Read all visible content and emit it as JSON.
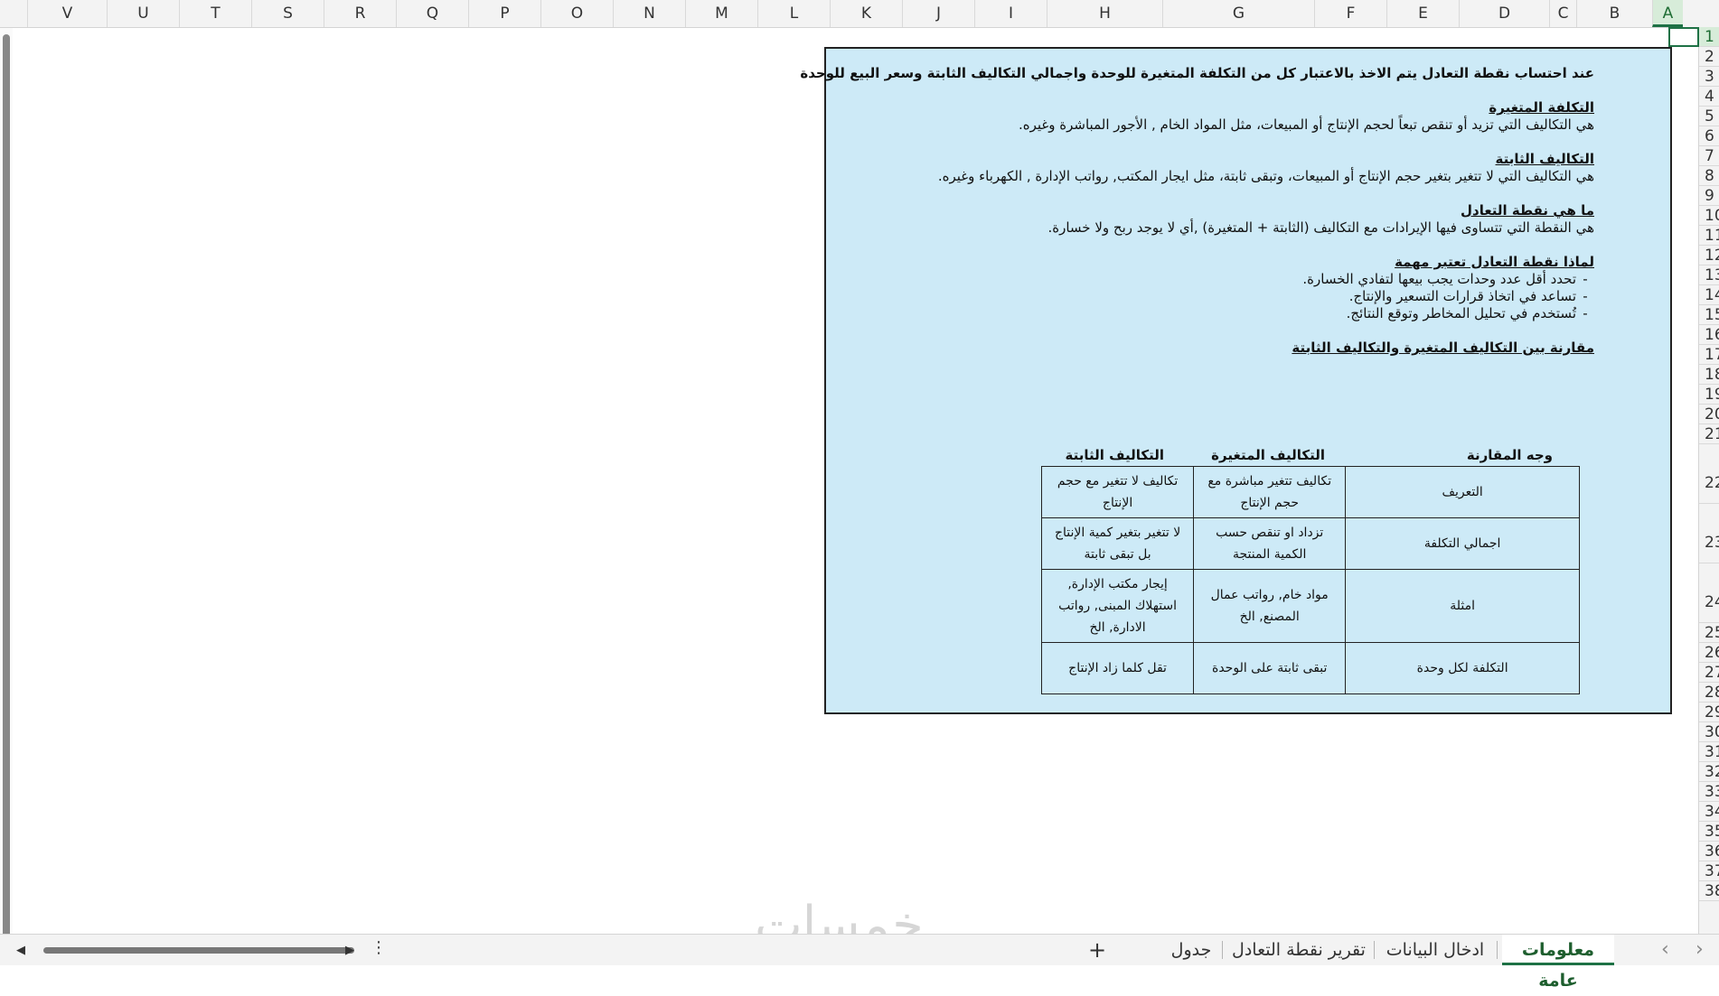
{
  "columns": [
    {
      "letter": "V"
    },
    {
      "letter": "U"
    },
    {
      "letter": "T"
    },
    {
      "letter": "S"
    },
    {
      "letter": "R"
    },
    {
      "letter": "Q"
    },
    {
      "letter": "P"
    },
    {
      "letter": "O"
    },
    {
      "letter": "N"
    },
    {
      "letter": "M"
    },
    {
      "letter": "L"
    },
    {
      "letter": "K"
    },
    {
      "letter": "J"
    },
    {
      "letter": "I"
    },
    {
      "letter": "H"
    },
    {
      "letter": "G"
    },
    {
      "letter": "F"
    },
    {
      "letter": "E"
    },
    {
      "letter": "D"
    },
    {
      "letter": "C"
    },
    {
      "letter": "B"
    },
    {
      "letter": "A"
    }
  ],
  "rows": [
    "1",
    "2",
    "3",
    "4",
    "5",
    "6",
    "7",
    "8",
    "9",
    "10",
    "11",
    "12",
    "13",
    "14",
    "15",
    "16",
    "17",
    "18",
    "19",
    "20",
    "21",
    "22",
    "23",
    "24",
    "25",
    "26",
    "27",
    "28",
    "29",
    "30",
    "31",
    "32",
    "33",
    "34",
    "35",
    "36",
    "37",
    "38"
  ],
  "selected_cell": "A1",
  "infobox": {
    "intro": "عند احتساب نقطة التعادل يتم الاخذ بالاعتبار كل من التكلفة المتغيرة للوحدة واجمالي التكاليف الثابتة وسعر البيع للوحدة",
    "variable_heading": "التكلفة المتغيرة",
    "variable_text": "هي التكاليف التي تزيد أو تنقص تبعاً لحجم الإنتاج أو المبيعات، مثل المواد الخام , الأجور المباشرة وغيره.",
    "fixed_heading": "التكاليف الثابتة",
    "fixed_text": "هي التكاليف التي لا تتغير بتغير حجم الإنتاج أو المبيعات، وتبقى ثابتة، مثل ايجار المكتب, رواتب الإدارة , الكهرباء وغيره.",
    "breakeven_heading": "ما هي نقطة التعادل",
    "breakeven_text": "هي النقطة التي تتساوى فيها الإيرادات مع التكاليف (الثابتة + المتغيرة) ,أي لا يوجد ربح ولا خسارة.",
    "importance_heading": "لماذا نقطة التعادل تعتبر مهمة",
    "importance_bullets": [
      "تحدد أقل عدد وحدات يجب بيعها لتفادي الخسارة.",
      "تساعد في اتخاذ قرارات التسعير والإنتاج.",
      "تُستخدم في تحليل المخاطر وتوقع النتائج."
    ],
    "comparison_heading": "مقارنة بين التكاليف المتغيرة والتكاليف الثابتة",
    "table_headers": {
      "aspect": "وجه المقارنة",
      "variable": "التكاليف المتغيرة",
      "fixed": "التكاليف الثابتة"
    },
    "table_rows": [
      {
        "aspect": "التعريف",
        "variable": "تكاليف تتغير مباشرة مع حجم الإنتاج",
        "fixed": "تكاليف لا تتغير مع حجم الإنتاج"
      },
      {
        "aspect": "اجمالي التكلفة",
        "variable": "تزداد او تنقص حسب الكمية المنتجة",
        "fixed": "لا تتغير بتغير كمية الإنتاج بل تبقى ثابتة"
      },
      {
        "aspect": "امثلة",
        "variable": "مواد خام, رواتب عمال المصنع, الخ",
        "fixed": "إيجار مكتب الإدارة, استهلاك المبنى, رواتب الادارة, الخ"
      },
      {
        "aspect": "التكلفة لكل وحدة",
        "variable": "تبقى ثابتة على الوحدة",
        "fixed": "تقل كلما زاد الإنتاج"
      }
    ]
  },
  "tabs": {
    "active": "معلومات عامة",
    "data_entry": "ادخال البيانات",
    "report": "تقرير نقطة التعادل",
    "table": "جدول",
    "add": "+"
  },
  "watermark": "خمسات",
  "colors": {
    "accent": "#1e7145",
    "box_fill": "#cdeaf7"
  }
}
